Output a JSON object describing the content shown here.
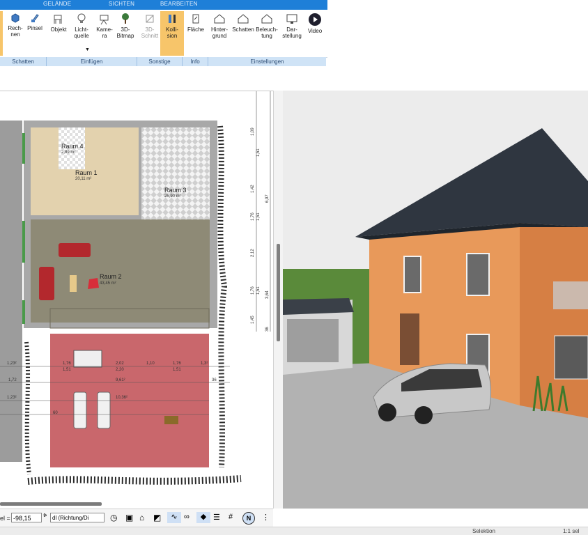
{
  "ribbon": {
    "tabs": [
      "GELÄNDE",
      "SICHTEN",
      "BEARBEITEN"
    ],
    "buttons": {
      "rechnen": "Rech-\nnen",
      "pinsel": "Pinsel",
      "objekt": "Objekt",
      "lichtquelle": "Licht-\nquelle",
      "kamera": "Kame-\nra",
      "bitmap3d": "3D-\nBitmap",
      "schnitt3d": "3D-\nSchnitt",
      "kollision": "Kolli-\nsion",
      "flaeche": "Fläche",
      "hintergrund": "Hinter-\ngrund",
      "schatten": "Schatten",
      "beleuchtung": "Beleuch-\ntung",
      "darstellung": "Dar-\nstellung",
      "video": "Video"
    },
    "groups": [
      "Schatten",
      "Einfügen",
      "Sonstige",
      "Info",
      "Einstellungen"
    ]
  },
  "plan": {
    "rooms": [
      {
        "name": "Raum 4",
        "area": "2,89 m²"
      },
      {
        "name": "Raum 1",
        "area": "20,11 m²"
      },
      {
        "name": "Raum 3",
        "area": "25,90 m²"
      },
      {
        "name": "Raum 2",
        "area": "43,45 m²"
      }
    ],
    "right_dimensions": [
      "1,09",
      "1,51",
      "1,42",
      "6,97",
      "1,76",
      "1,51",
      "2,12",
      "1,76",
      "1,51",
      "3,64",
      "1,45",
      "36"
    ],
    "bottom_dimensions": {
      "row1": [
        "1,23²",
        "1,76",
        "2,02",
        "1,10",
        "1,76",
        "1,3²"
      ],
      "row2": [
        "1,51",
        "2,20",
        "1,51"
      ],
      "row3": [
        "1,72",
        "9,61²",
        "36"
      ],
      "row4": [
        "1,23²",
        "10,36²"
      ],
      "row5": [
        "60"
      ]
    }
  },
  "bottombar": {
    "angle_label": "el =",
    "angle_value": "-98,15",
    "angle_unit": "°",
    "direction_select": "dl (Richtung/Di"
  },
  "statusbar": {
    "mode": "Selektion",
    "scale": "1:1 sel"
  },
  "colors": {
    "accent": "#1e7fd8",
    "active_button": "#f7c56a",
    "house_wall": "#e8995a",
    "roof": "#2f3640",
    "driveway": "#b2b2b2",
    "lawn": "#5a8a3a",
    "terrace": "#c9676c",
    "wood_floor": "#e3d2ae",
    "living_floor": "#8e8a76"
  }
}
